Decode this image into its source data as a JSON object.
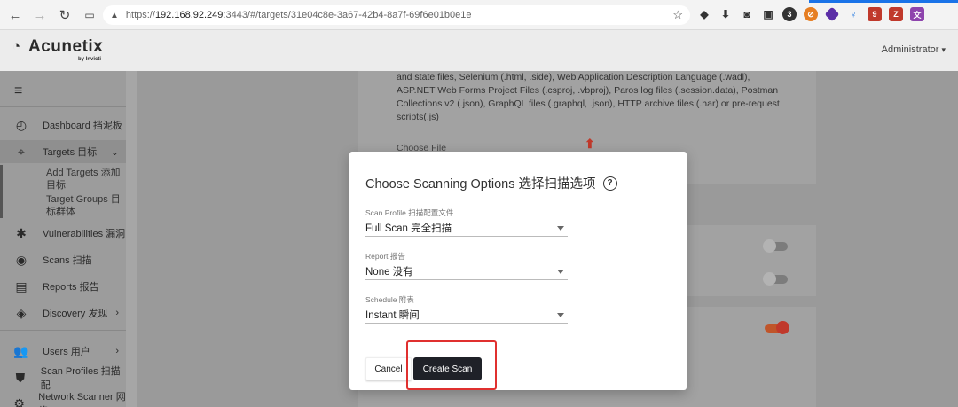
{
  "browser": {
    "url_prefix": "https://",
    "url_host": "192.168.92.249",
    "url_rest": ":3443/#/targets/31e04c8e-3a67-42b4-8a7f-69f6e01b0e1e",
    "ext_badge": "9"
  },
  "header": {
    "logo": "Acunetix",
    "logo_sub": "by Invicti",
    "user": "Administrator"
  },
  "sidebar": {
    "items": [
      {
        "label": "Dashboard 挡泥板"
      },
      {
        "label": "Targets 目标"
      },
      {
        "label": "Vulnerabilities 漏洞"
      },
      {
        "label": "Scans 扫描"
      },
      {
        "label": "Reports 报告"
      },
      {
        "label": "Discovery 发现"
      },
      {
        "label": "Users 用户"
      },
      {
        "label": "Scan Profiles 扫描配"
      },
      {
        "label": "Network Scanner 网络"
      }
    ],
    "sub_items": [
      {
        "label": "Add Targets 添加目标"
      },
      {
        "label": "Target Groups 目标群体"
      }
    ]
  },
  "background": {
    "file_types_text": "and state files, Selenium (.html, .side), Web Application Description Language (.wadl), ASP.NET Web Forms Project Files (.csproj, .vbproj), Paros log files (.session.data), Postman Collections v2 (.json), GraphQL files (.graphql, .json), HTTP archive files (.har) or pre-request scripts(.js)",
    "choose_file": "Choose File"
  },
  "modal": {
    "title": "Choose Scanning Options 选择扫描选项",
    "help": "?",
    "fields": [
      {
        "label": "Scan Profile 扫描配置文件",
        "value": "Full Scan 完全扫描"
      },
      {
        "label": "Report 报告",
        "value": "None 没有"
      },
      {
        "label": "Schedule 附表",
        "value": "Instant 瞬间"
      }
    ],
    "cancel": "Cancel",
    "create": "Create Scan"
  },
  "colors": {
    "accent_red": "#e0302f",
    "primary_button": "#1f2128"
  }
}
